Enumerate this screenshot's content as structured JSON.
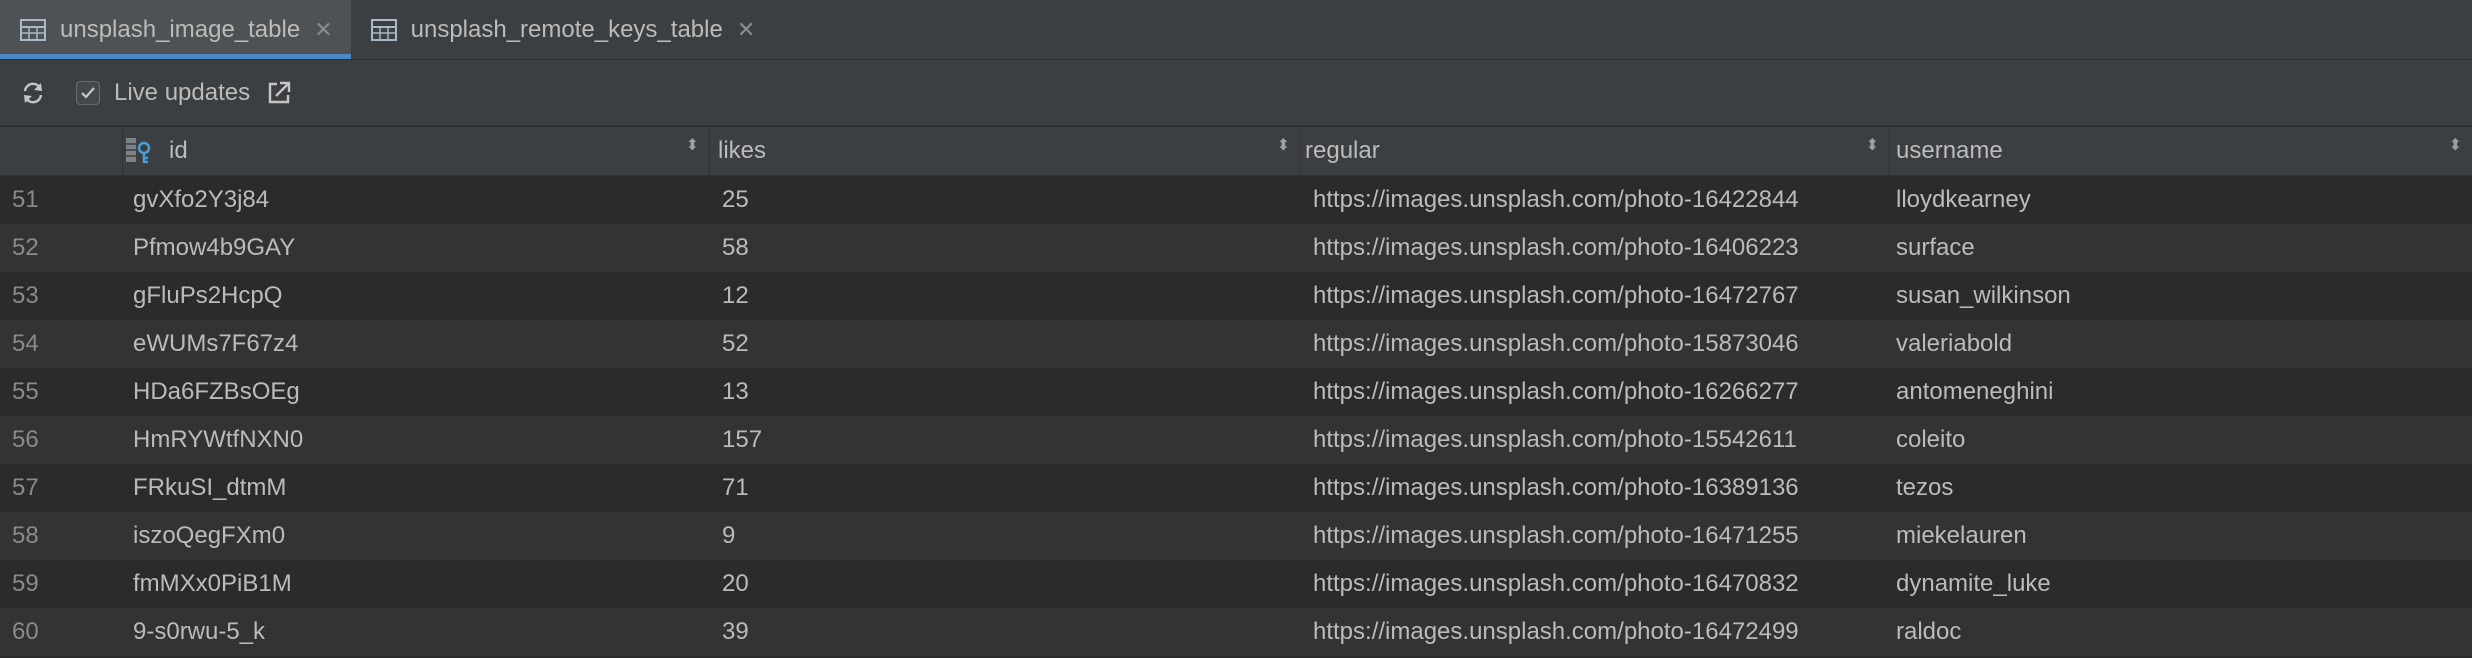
{
  "tabs": [
    {
      "label": "unsplash_image_table",
      "active": true
    },
    {
      "label": "unsplash_remote_keys_table",
      "active": false
    }
  ],
  "toolbar": {
    "live_updates_label": "Live updates",
    "live_updates_checked": true
  },
  "columns": [
    "id",
    "likes",
    "regular",
    "username"
  ],
  "rows": [
    {
      "n": "51",
      "id": "gvXfo2Y3j84",
      "likes": "25",
      "regular": "https://images.unsplash.com/photo-16422844",
      "username": "lloydkearney"
    },
    {
      "n": "52",
      "id": "Pfmow4b9GAY",
      "likes": "58",
      "regular": "https://images.unsplash.com/photo-16406223",
      "username": "surface"
    },
    {
      "n": "53",
      "id": "gFluPs2HcpQ",
      "likes": "12",
      "regular": "https://images.unsplash.com/photo-16472767",
      "username": "susan_wilkinson"
    },
    {
      "n": "54",
      "id": "eWUMs7F67z4",
      "likes": "52",
      "regular": "https://images.unsplash.com/photo-15873046",
      "username": "valeriabold"
    },
    {
      "n": "55",
      "id": "HDa6FZBsOEg",
      "likes": "13",
      "regular": "https://images.unsplash.com/photo-16266277",
      "username": "antomeneghini"
    },
    {
      "n": "56",
      "id": "HmRYWtfNXN0",
      "likes": "157",
      "regular": "https://images.unsplash.com/photo-15542611",
      "username": "coleito"
    },
    {
      "n": "57",
      "id": "FRkuSI_dtmM",
      "likes": "71",
      "regular": "https://images.unsplash.com/photo-16389136",
      "username": "tezos"
    },
    {
      "n": "58",
      "id": "iszoQegFXm0",
      "likes": "9",
      "regular": "https://images.unsplash.com/photo-16471255",
      "username": "miekelauren"
    },
    {
      "n": "59",
      "id": "fmMXx0PiB1M",
      "likes": "20",
      "regular": "https://images.unsplash.com/photo-16470832",
      "username": "dynamite_luke"
    },
    {
      "n": "60",
      "id": "9-s0rwu-5_k",
      "likes": "39",
      "regular": "https://images.unsplash.com/photo-16472499",
      "username": "raldoc"
    }
  ],
  "icons": {
    "table": "table-icon",
    "close": "close-icon",
    "refresh": "refresh-icon",
    "open_external": "open-external-icon",
    "primary_key": "primary-key-column-icon",
    "sort": "sort-icon"
  },
  "colors": {
    "background": "#2b2b2b",
    "panel": "#3c3f41",
    "accent": "#4a88c7",
    "text": "#bbbbbb"
  }
}
